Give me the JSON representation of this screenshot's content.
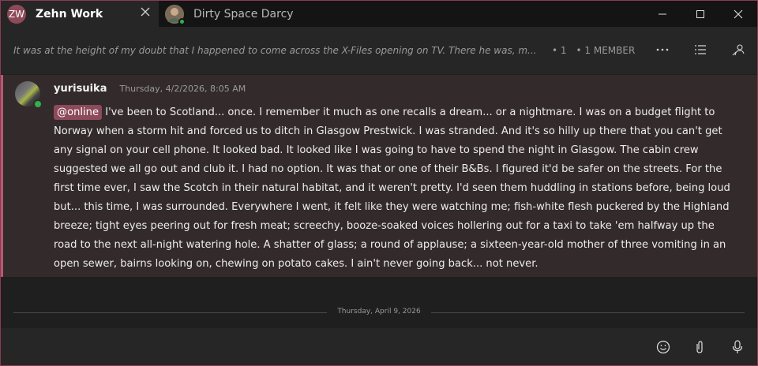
{
  "tabs": [
    {
      "avatar_text": "ZW",
      "title": "Zehn Work",
      "close_icon": "close-icon"
    },
    {
      "avatar_icon": "user-avatar-icon",
      "title": "Dirty Space Darcy"
    }
  ],
  "window_controls": [
    "minimize-icon",
    "maximize-icon",
    "close-icon"
  ],
  "header": {
    "topic": "It was at the height of my doubt that I happened to come across the X-Files opening on TV. There he was, m...",
    "count": "• 1",
    "members": "• 1 MEMBER",
    "icons": [
      "more-icon",
      "thread-list-icon",
      "members-icon"
    ]
  },
  "message": {
    "author": "yurisuika",
    "timestamp": "Thursday, 4/2/2026, 8:05 AM",
    "mention": "@online",
    "text": " I've been to Scotland... once. I remember it much as one recalls a dream... or a nightmare. I was on a budget flight to Norway when a storm hit and forced us to ditch in Glasgow Prestwick. I was stranded. And it's so hilly up there that you can't get any signal on your cell phone. It looked bad. It looked like I was going to have to spend the night in Glasgow. The cabin crew suggested we all go out and club it. I had no option. It was that or one of their B&Bs. I figured it'd be safer on the streets. For the first time ever, I saw the Scotch in their natural habitat, and it weren't pretty. I'd seen them huddling in stations before, being loud but... this time, I was surrounded. Everywhere I went, it felt like they were watching me; fish-white flesh puckered by the Highland breeze; tight eyes peering out for fresh meat; screechy, booze-soaked voices hollering out for a taxi to take 'em halfway up the road to the next all-night watering hole. A shatter of glass; a round of applause; a sixteen-year-old mother of three vomiting in an open sewer, bairns looking on, chewing on potato cakes. I ain't never going back... not never."
  },
  "separator": {
    "date": "Thursday, April 9, 2026"
  },
  "composer": {
    "icons": [
      "emoji-icon",
      "attach-icon",
      "microphone-icon"
    ]
  },
  "colors": {
    "accent": "#b45a72",
    "mention_bg": "#8c4a5a",
    "presence": "#2eb34a",
    "message_bg": "#332b2b"
  }
}
